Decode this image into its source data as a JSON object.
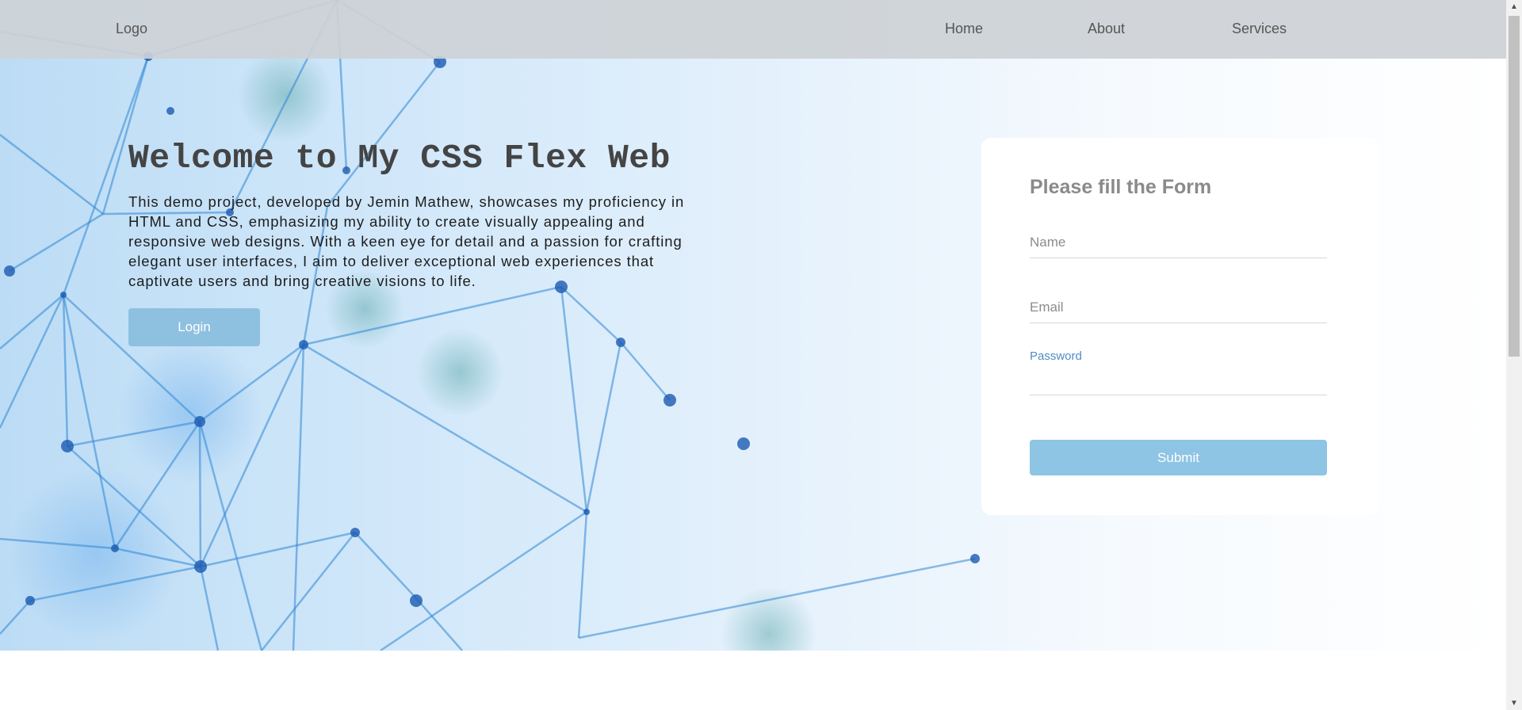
{
  "nav": {
    "logo": "Logo",
    "links": [
      "Home",
      "About",
      "Services"
    ]
  },
  "hero": {
    "title": "Welcome to My CSS Flex Web",
    "description": "This demo project, developed by Jemin Mathew, showcases my proficiency in HTML and CSS, emphasizing my ability to create visually appealing and responsive web designs. With a keen eye for detail and a passion for crafting elegant user interfaces, I aim to deliver exceptional web experiences that captivate users and bring creative visions to life.",
    "login_label": "Login"
  },
  "form": {
    "title": "Please fill the Form",
    "name_placeholder": "Name",
    "email_placeholder": "Email",
    "password_label": "Password",
    "submit_label": "Submit"
  },
  "colors": {
    "accent": "#8ec0e0",
    "nav_bg": "#cdd1d6",
    "password_label": "#4f8cc4"
  }
}
